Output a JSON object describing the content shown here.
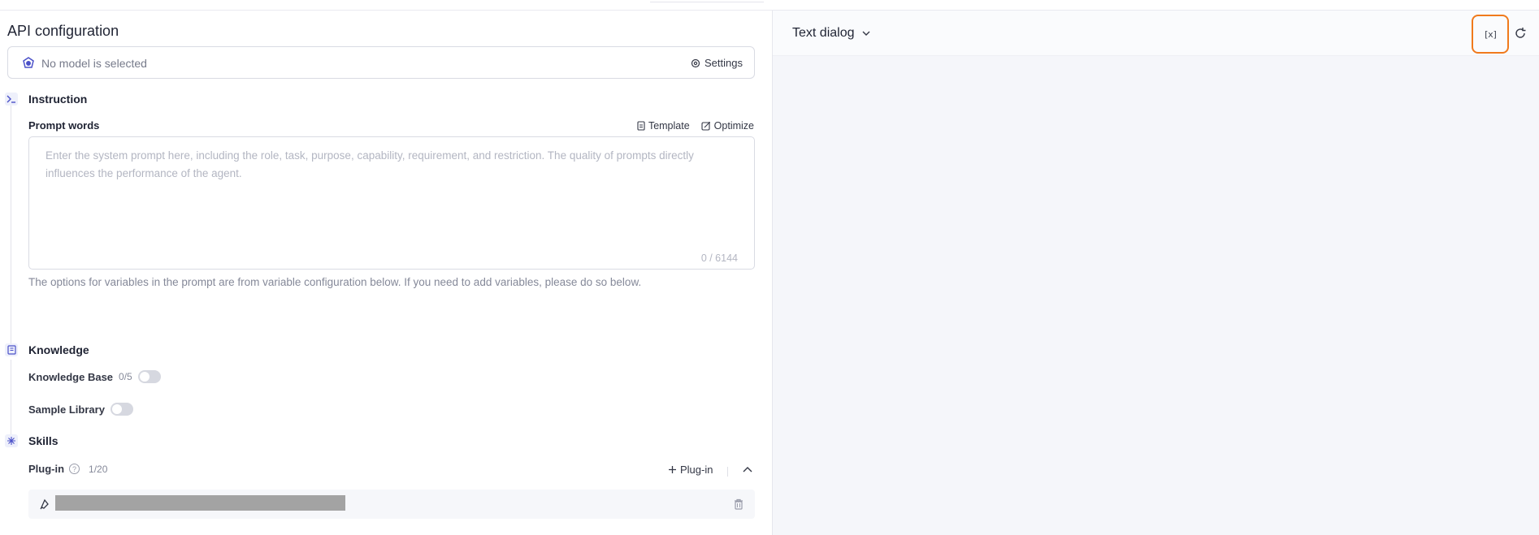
{
  "api": {
    "title": "API configuration",
    "model_placeholder": "No model is selected",
    "settings_label": "Settings"
  },
  "instruction": {
    "title": "Instruction",
    "prompt_label": "Prompt words",
    "template_label": "Template",
    "optimize_label": "Optimize",
    "placeholder": "Enter the system prompt here, including the role, task, purpose, capability, requirement, and restriction. The quality of prompts directly influences the performance of the agent.",
    "counter": "0 / 6144",
    "hint": "The options for variables in the prompt are from variable configuration below. If you need to add variables, please do so below."
  },
  "knowledge": {
    "title": "Knowledge",
    "knowledge_base_label": "Knowledge Base",
    "knowledge_base_count": "0/5",
    "sample_library_label": "Sample Library"
  },
  "skills": {
    "title": "Skills",
    "plugin_label": "Plug-in",
    "plugin_count": "1/20",
    "add_plugin_label": "Plug-in",
    "help_glyph": "?"
  },
  "dialog": {
    "title": "Text dialog",
    "variable_icon_glyph": "[x]"
  },
  "colors": {
    "accent_highlight": "#f07a1c",
    "brand_icon": "#4a50c8"
  }
}
